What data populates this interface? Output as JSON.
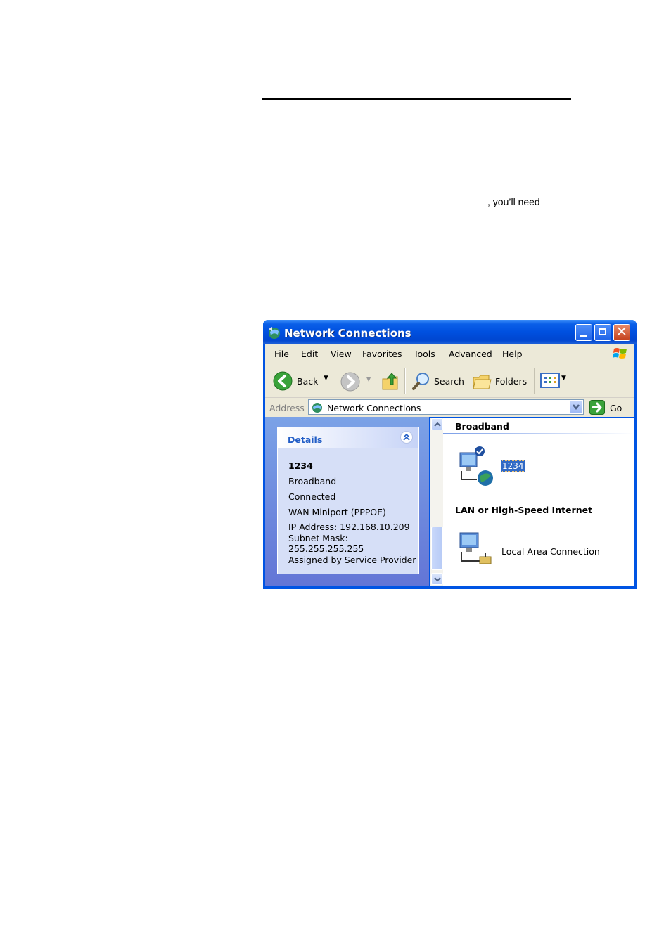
{
  "document": {
    "fragment": ", you’ll need"
  },
  "window": {
    "title": "Network Connections",
    "menu": [
      "File",
      "Edit",
      "View",
      "Favorites",
      "Tools",
      "Advanced",
      "Help"
    ],
    "toolbar": {
      "back_label": "Back",
      "search_label": "Search",
      "folders_label": "Folders"
    },
    "address": {
      "label": "Address",
      "value": "Network Connections",
      "go_label": "Go"
    },
    "details": {
      "title": "Details",
      "name": "1234",
      "type": "Broadband",
      "status": "Connected",
      "device": "WAN Miniport (PPPOE)",
      "ip": "IP Address: 192.168.10.209",
      "mask_label": "Subnet Mask:",
      "mask_value": "255.255.255.255",
      "assigned": "Assigned by Service Provider"
    },
    "groups": {
      "broadband_title": "Broadband",
      "broadband_item": "1234",
      "lan_title": "LAN or High-Speed Internet",
      "lan_item": "Local Area Connection"
    },
    "colors": {
      "title_blue": "#0054e3",
      "pane_blue": "#6b8fe0",
      "selection": "#316ac5"
    }
  }
}
